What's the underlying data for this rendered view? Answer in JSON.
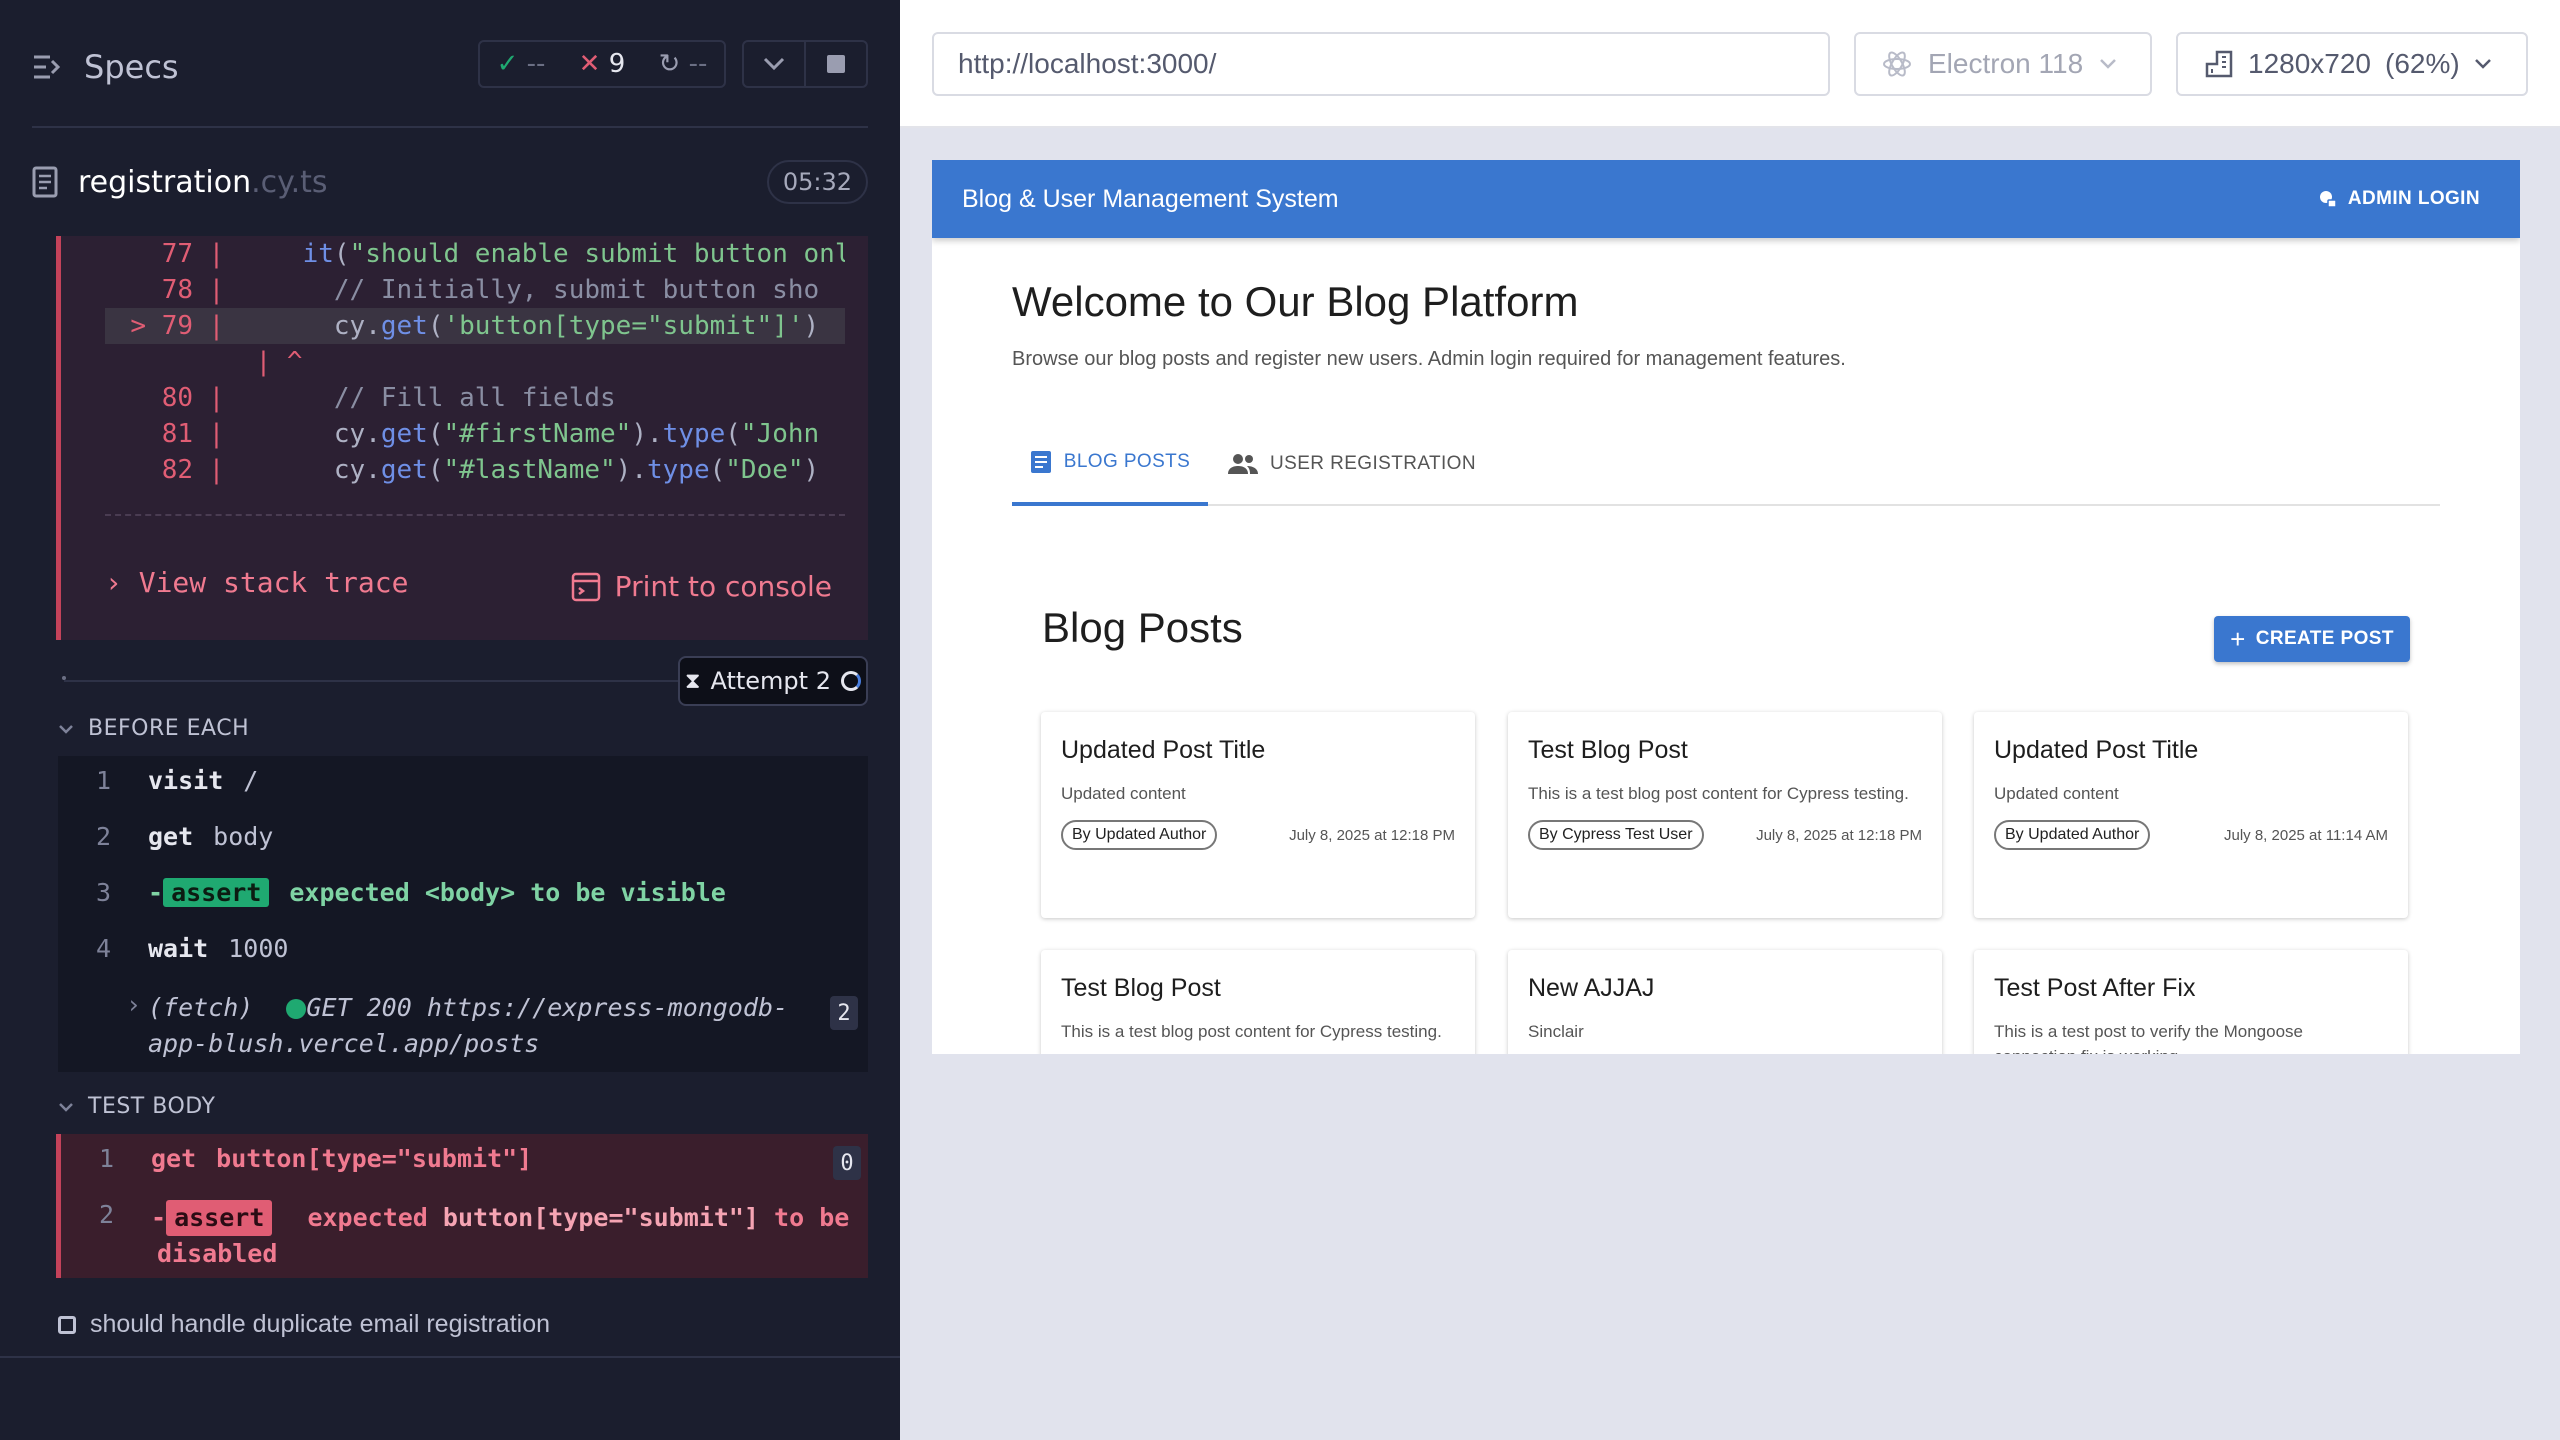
{
  "runner": {
    "specs_label": "Specs",
    "stats": {
      "passed": "--",
      "failed": "9",
      "pending": "--"
    },
    "file_name": "registration",
    "file_ext": ".cy.ts",
    "timer": "05:32"
  },
  "error": {
    "code_lines": [
      {
        "ln": "77",
        "text": "    it(\"should enable submit button onl"
      },
      {
        "ln": "78",
        "text": "      // Initially, submit button sho"
      },
      {
        "ln": "79",
        "text": "      cy.get('button[type=\"submit\"]')"
      },
      {
        "ln": "",
        "text": " ^"
      },
      {
        "ln": "80",
        "text": "      // Fill all fields"
      },
      {
        "ln": "81",
        "text": "      cy.get(\"#firstName\").type(\"John"
      },
      {
        "ln": "82",
        "text": "      cy.get(\"#lastName\").type(\"Doe\")"
      }
    ],
    "highlight_marker": ">",
    "view_stack_trace": "View stack trace",
    "print_to_console": "Print to console"
  },
  "attempt": {
    "label": "Attempt 2"
  },
  "before_each": {
    "header": "BEFORE EACH",
    "commands": [
      {
        "num": "1",
        "name": "visit",
        "arg": "/"
      },
      {
        "num": "2",
        "name": "get",
        "arg": "body"
      },
      {
        "num": "3",
        "prefix": "-",
        "badge": "assert",
        "msg": "expected <body> to be visible"
      },
      {
        "num": "4",
        "name": "wait",
        "arg": "1000"
      }
    ],
    "fetch": {
      "label": "(fetch)",
      "method": "GET 200 https://express-mongodb-",
      "url_rest": "app-blush.vercel.app/posts",
      "count": "2"
    }
  },
  "test_body": {
    "header": "TEST BODY",
    "commands": [
      {
        "num": "1",
        "name": "get",
        "arg": "button[type=\"submit\"]",
        "count": "0"
      },
      {
        "num": "2",
        "prefix": "-",
        "badge": "assert",
        "msg1": "expected ",
        "msg_sel": "button[type=\"submit\"]",
        "msg2": " to be",
        "msg3": "disabled"
      }
    ]
  },
  "next_test": "should handle duplicate email registration",
  "browser": {
    "url": "http://localhost:3000/",
    "name": "Electron 118",
    "viewport": "1280x720",
    "scale": "(62%)"
  },
  "app": {
    "title": "Blog & User Management System",
    "admin_login": "ADMIN LOGIN",
    "welcome": "Welcome to Our Blog Platform",
    "welcome_sub": "Browse our blog posts and register new users. Admin login required for management features.",
    "tabs": [
      "BLOG POSTS",
      "USER REGISTRATION"
    ],
    "posts_title": "Blog Posts",
    "create_post": "CREATE POST",
    "posts": [
      {
        "title": "Updated Post Title",
        "content": "Updated content",
        "author": "By Updated Author",
        "date": "July 8, 2025 at 12:18 PM"
      },
      {
        "title": "Test Blog Post",
        "content": "This is a test blog post content for Cypress testing.",
        "author": "By Cypress Test User",
        "date": "July 8, 2025 at 12:18 PM"
      },
      {
        "title": "Updated Post Title",
        "content": "Updated content",
        "author": "By Updated Author",
        "date": "July 8, 2025 at 11:14 AM"
      },
      {
        "title": "Test Blog Post",
        "content": "This is a test blog post content for Cypress testing.",
        "author": "",
        "date": ""
      },
      {
        "title": "New AJJAJ",
        "content": "Sinclair",
        "author": "",
        "date": ""
      },
      {
        "title": "Test Post After Fix",
        "content": "This is a test post to verify the Mongoose connection fix is working.",
        "author": "",
        "date": ""
      }
    ]
  },
  "colors": {
    "accent": "#3a77cf",
    "fail": "#e05d74",
    "pass": "#1fa971",
    "panel": "#1b1e2e"
  }
}
